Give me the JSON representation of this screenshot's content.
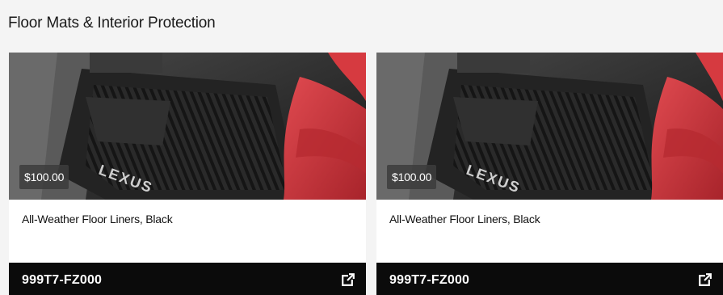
{
  "section": {
    "title": "Floor Mats & Interior Protection"
  },
  "products": [
    {
      "price": "$100.00",
      "name": "All-Weather Floor Liners, Black",
      "part_number": "999T7-FZ000",
      "image": "floor-liner-photo",
      "link_icon": "external-link-icon"
    },
    {
      "price": "$100.00",
      "name": "All-Weather Floor Liners, Black",
      "part_number": "999T7-FZ000",
      "image": "floor-liner-photo",
      "link_icon": "external-link-icon"
    }
  ],
  "colors": {
    "page_bg": "#f4f4f4",
    "card_bg": "#ffffff",
    "footer_bg": "#0b0b0b",
    "seat_red": "#c8323a"
  }
}
